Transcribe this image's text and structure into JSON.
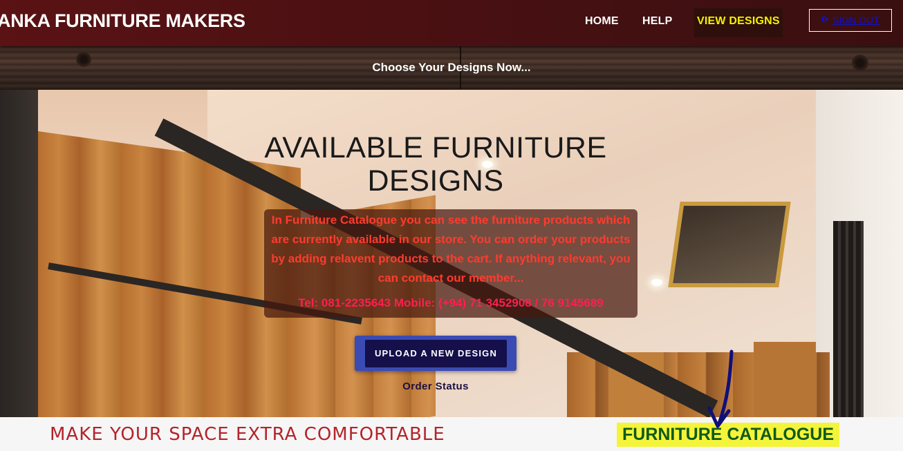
{
  "nav": {
    "brand": "ANKA FURNITURE MAKERS",
    "home": "HOME",
    "help": "HELP",
    "view_designs": "VIEW DESIGNS",
    "sign_out": "SIGN OUT",
    "sign_out_icon": "sign-out-icon",
    "active_color": "#f2f200"
  },
  "banner": {
    "tagline": "Choose Your Designs Now..."
  },
  "hero": {
    "title": "AVAILABLE FURNITURE DESIGNS",
    "description": "In Furniture Catalogue you can see the furniture products which are currently available in our store. You can order your products by adding relavent products to the cart. If anything relevant, you can contact our member...",
    "contact": "Tel: 081-2235643 Mobile: (+94) 71 3452908 / 76 9145689",
    "upload_button": "UPLOAD A NEW DESIGN",
    "order_status": "Order Status"
  },
  "footer_strip": {
    "slogan": "MAKE YOUR SPACE EXTRA COMFORTABLE",
    "catalogue_label": "FURNITURE CATALOGUE",
    "highlight_color": "#f4f43a"
  }
}
